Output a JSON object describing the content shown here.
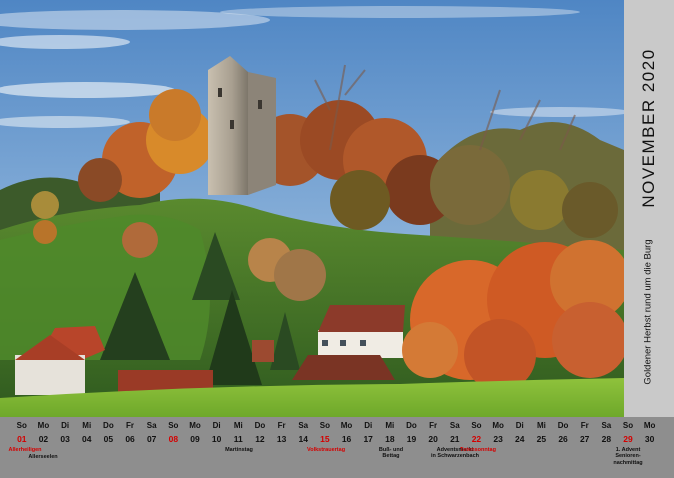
{
  "calendar": {
    "month_title": "NOVEMBER 2020",
    "caption": "Goldener Herbst rund um die Burg",
    "days": [
      {
        "weekday": "So",
        "date": "01",
        "red": true
      },
      {
        "weekday": "Mo",
        "date": "02",
        "red": false
      },
      {
        "weekday": "Di",
        "date": "03",
        "red": false
      },
      {
        "weekday": "Mi",
        "date": "04",
        "red": false
      },
      {
        "weekday": "Do",
        "date": "05",
        "red": false
      },
      {
        "weekday": "Fr",
        "date": "06",
        "red": false
      },
      {
        "weekday": "Sa",
        "date": "07",
        "red": false
      },
      {
        "weekday": "So",
        "date": "08",
        "red": true
      },
      {
        "weekday": "Mo",
        "date": "09",
        "red": false
      },
      {
        "weekday": "Di",
        "date": "10",
        "red": false
      },
      {
        "weekday": "Mi",
        "date": "11",
        "red": false
      },
      {
        "weekday": "Do",
        "date": "12",
        "red": false
      },
      {
        "weekday": "Fr",
        "date": "13",
        "red": false
      },
      {
        "weekday": "Sa",
        "date": "14",
        "red": false
      },
      {
        "weekday": "So",
        "date": "15",
        "red": true
      },
      {
        "weekday": "Mo",
        "date": "16",
        "red": false
      },
      {
        "weekday": "Di",
        "date": "17",
        "red": false
      },
      {
        "weekday": "Mi",
        "date": "18",
        "red": false
      },
      {
        "weekday": "Do",
        "date": "19",
        "red": false
      },
      {
        "weekday": "Fr",
        "date": "20",
        "red": false
      },
      {
        "weekday": "Sa",
        "date": "21",
        "red": false
      },
      {
        "weekday": "So",
        "date": "22",
        "red": true
      },
      {
        "weekday": "Mo",
        "date": "23",
        "red": false
      },
      {
        "weekday": "Di",
        "date": "24",
        "red": false
      },
      {
        "weekday": "Mi",
        "date": "25",
        "red": false
      },
      {
        "weekday": "Do",
        "date": "26",
        "red": false
      },
      {
        "weekday": "Fr",
        "date": "27",
        "red": false
      },
      {
        "weekday": "Sa",
        "date": "28",
        "red": false
      },
      {
        "weekday": "So",
        "date": "29",
        "red": true
      },
      {
        "weekday": "Mo",
        "date": "30",
        "red": false
      }
    ],
    "notes": {
      "allerheiligen": "Allerheiligen",
      "allerseelen": "Allerseelen",
      "martinstag": "Martinstag",
      "volkstrauertag": "Volkstrauertag",
      "buss_und_bettag_1": "Buß- und",
      "buss_und_bettag_2": "Bettag",
      "adventsmarkt_1": "Adventsmarkt",
      "adventsmarkt_2": "in Schwarzenbach",
      "totensonntag": "Totensonntag",
      "advent_1": "1. Advent",
      "advent_2": "Senioren-",
      "advent_3": "nachmittag"
    }
  }
}
